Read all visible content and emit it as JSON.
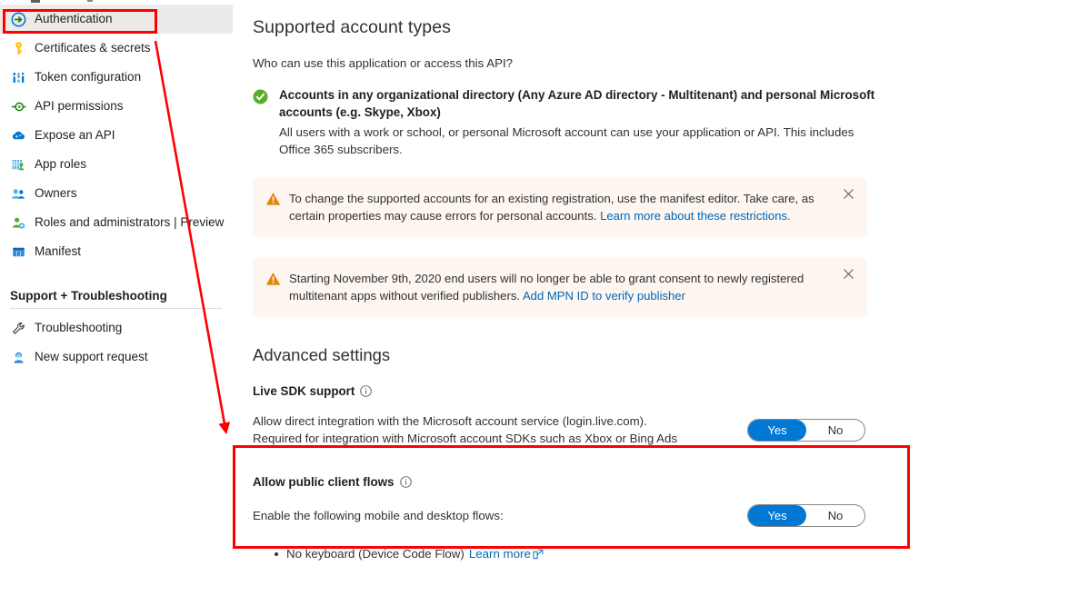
{
  "sidebar": {
    "items": [
      {
        "label": "Authentication",
        "icon": "authentication-icon",
        "selected": true
      },
      {
        "label": "Certificates & secrets",
        "icon": "key-icon",
        "selected": false
      },
      {
        "label": "Token configuration",
        "icon": "token-configuration-icon",
        "selected": false
      },
      {
        "label": "API permissions",
        "icon": "api-permissions-icon",
        "selected": false
      },
      {
        "label": "Expose an API",
        "icon": "cloud-api-icon",
        "selected": false
      },
      {
        "label": "App roles",
        "icon": "app-roles-icon",
        "selected": false
      },
      {
        "label": "Owners",
        "icon": "owners-people-icon",
        "selected": false
      },
      {
        "label": "Roles and administrators | Preview",
        "icon": "roles-administrators-icon",
        "selected": false
      },
      {
        "label": "Manifest",
        "icon": "manifest-icon",
        "selected": false
      }
    ],
    "group_title": "Support + Troubleshooting",
    "support_items": [
      {
        "label": "Troubleshooting",
        "icon": "wrench-icon"
      },
      {
        "label": "New support request",
        "icon": "support-person-icon"
      }
    ]
  },
  "main": {
    "supported_account_types": {
      "heading": "Supported account types",
      "question": "Who can use this application or access this API?",
      "selected_option_title": "Accounts in any organizational directory (Any Azure AD directory - Multitenant) and personal Microsoft accounts (e.g. Skype, Xbox)",
      "selected_option_desc": "All users with a work or school, or personal Microsoft account can use your application or API. This includes Office 365 subscribers."
    },
    "banners": [
      {
        "text": "To change the supported accounts for an existing registration, use the manifest editor. Take care, as certain properties may cause errors for personal accounts.",
        "link": "Learn more about these restrictions.",
        "close_label": "✕"
      },
      {
        "text": "Starting November 9th, 2020 end users will no longer be able to grant consent to newly registered multitenant apps without verified publishers.",
        "link": "Add MPN ID to verify publisher",
        "close_label": "✕"
      }
    ],
    "advanced_settings": {
      "heading": "Advanced settings",
      "live_sdk": {
        "label": "Live SDK support",
        "desc_line1": "Allow direct integration with the Microsoft account service (login.live.com).",
        "desc_line2": "Required for integration with Microsoft account SDKs such as Xbox or Bing Ads",
        "toggle_yes": "Yes",
        "toggle_no": "No",
        "value": "Yes"
      },
      "public_client": {
        "label": "Allow public client flows",
        "desc": "Enable the following mobile and desktop flows:",
        "toggle_yes": "Yes",
        "toggle_no": "No",
        "value": "Yes",
        "bullet_text": "No keyboard (Device Code Flow)",
        "bullet_link": "Learn more"
      }
    }
  },
  "annotations": {
    "highlight_color": "#ff0000",
    "arrow_label": "arrow-pointing-to-allow-public-client-flows",
    "rect_label": "highlight-allow-public-client-flows"
  },
  "colors": {
    "accent_blue": "#0078d4",
    "link_blue": "#0067b8",
    "banner_bg": "#fdf6f1",
    "warning_orange": "#e8820c",
    "success_green": "#5aad2b",
    "selected_nav_bg": "#edebe9",
    "annotation_red": "#ff0000"
  }
}
